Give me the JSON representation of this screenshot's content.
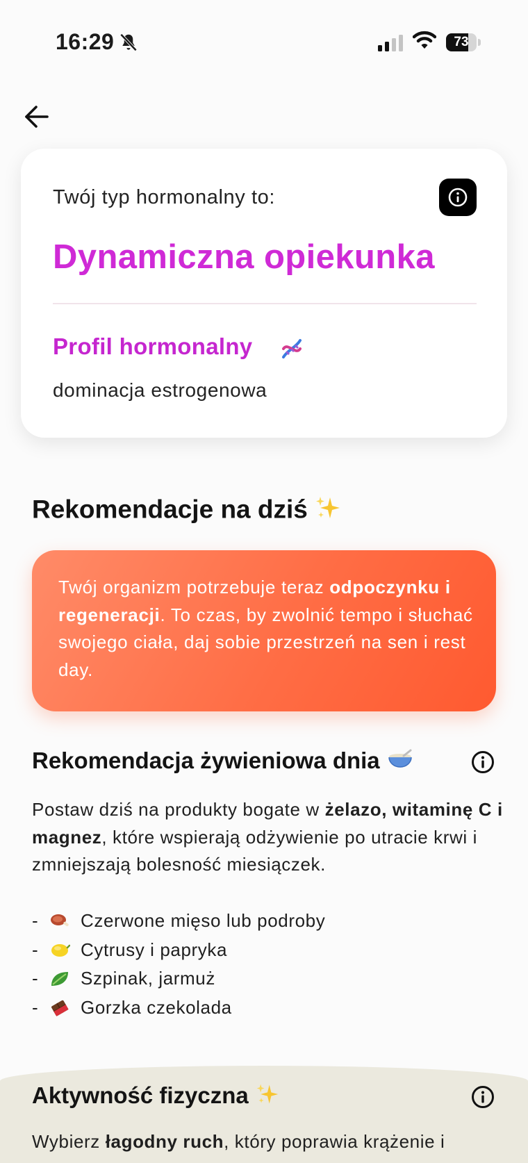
{
  "status_bar": {
    "time": "16:29",
    "battery_level": 73,
    "battery_text": "73"
  },
  "header": {
    "back_icon": "arrow-left-icon"
  },
  "profile_card": {
    "label": "Twój typ hormonalny to:",
    "info_icon": "info-icon",
    "type_name": "Dynamiczna opiekunka",
    "profile_title": "Profil hormonalny",
    "profile_icon": "dna-icon",
    "profile_value": "dominacja estrogenowa",
    "accent_color": "#cf2ad6"
  },
  "recommendations": {
    "title": "Rekomendacje na dziś",
    "title_icon": "sparkles-icon",
    "callout": {
      "part1": "Twój organizm potrzebuje teraz ",
      "bold": "odpoczynku i regeneracji",
      "part2": ". To czas, by zwolnić tempo i słuchać swojego ciała, daj sobie przestrzeń na sen i rest day.",
      "color": "#ff6d45"
    }
  },
  "nutrition": {
    "title": "Rekomendacja żywieniowa dnia",
    "title_icon": "bowl-icon",
    "info_icon": "info-icon",
    "text_part1": "Postaw dziś na produkty bogate w ",
    "text_bold": "żelazo, witaminę C i magnez",
    "text_part2": ", które wspierają odżywienie po utracie krwi i zmniejszają bolesność miesiączek.",
    "items": [
      {
        "dash": "-",
        "icon": "meat-icon",
        "label": "Czerwone mięso lub podroby"
      },
      {
        "dash": "-",
        "icon": "lemon-icon",
        "label": "Cytrusy i papryka"
      },
      {
        "dash": "-",
        "icon": "leafy-greens-icon",
        "label": "Szpinak, jarmuż"
      },
      {
        "dash": "-",
        "icon": "chocolate-icon",
        "label": "Gorzka czekolada"
      }
    ]
  },
  "activity": {
    "title": "Aktywność fizyczna",
    "title_icon": "sparkles-icon",
    "info_icon": "info-icon",
    "text_part1": "Wybierz ",
    "text_bold": "łagodny ruch",
    "text_part2": ", który poprawia krążenie i"
  }
}
